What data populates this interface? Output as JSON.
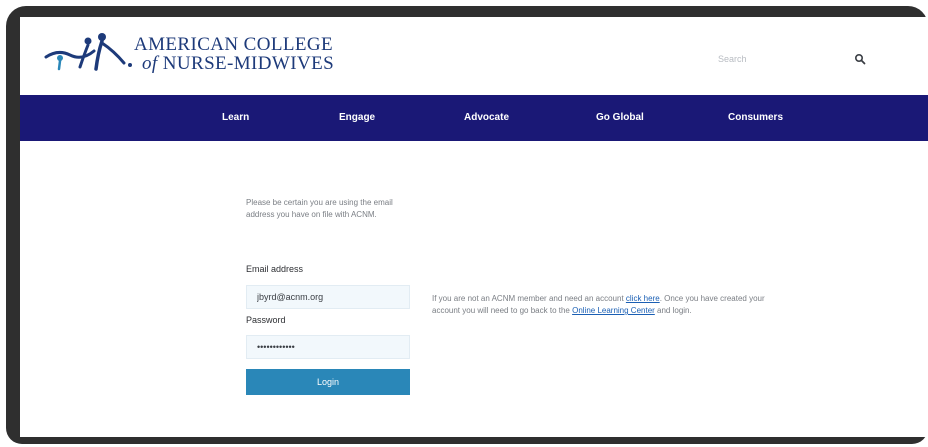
{
  "header": {
    "logo_line1": "AMERICAN COLLEGE",
    "logo_line2_prefix": "of",
    "logo_line2_main": "NURSE-MIDWIVES",
    "search_placeholder": "Search"
  },
  "nav": {
    "items": [
      {
        "label": "Learn"
      },
      {
        "label": "Engage"
      },
      {
        "label": "Advocate"
      },
      {
        "label": "Go Global"
      },
      {
        "label": "Consumers"
      }
    ]
  },
  "login": {
    "intro": "Please be certain you are using the email address you have on file with ACNM.",
    "email_label": "Email address",
    "email_value": "jbyrd@acnm.org",
    "password_label": "Password",
    "password_value": "••••••••••••",
    "button_label": "Login"
  },
  "side_note": {
    "text1": "If you are not an ACNM member and need an account ",
    "link1": "click here",
    "text2": ". Once you have created your account you will need to go back to the ",
    "link2": "Online Learning Center",
    "text3": " and login."
  },
  "colors": {
    "nav_bg": "#1a1876",
    "brand": "#1d3a7a",
    "button": "#2a87b8",
    "link": "#1a5fb4"
  }
}
